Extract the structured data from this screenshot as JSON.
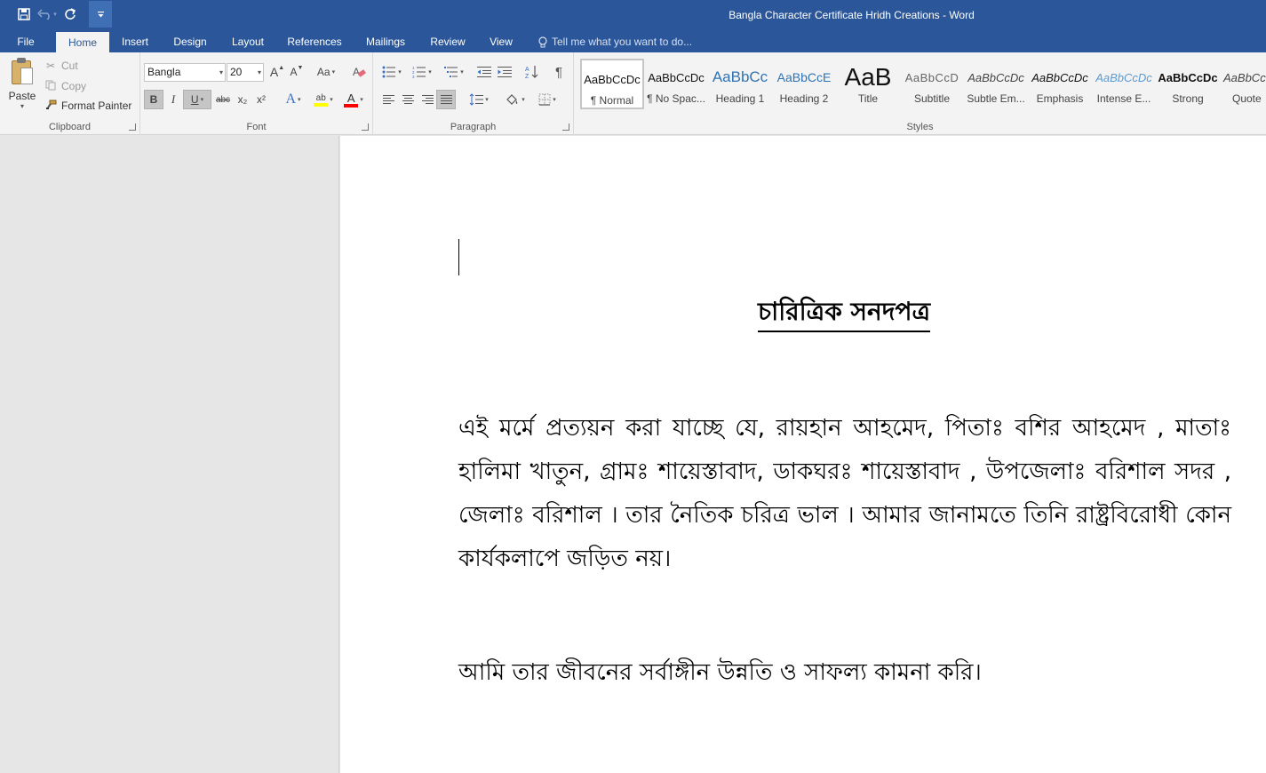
{
  "window": {
    "title": "Bangla Character Certificate Hridh Creations - Word"
  },
  "quick_access": {
    "save_icon": "save-icon",
    "undo_icon": "undo-icon",
    "redo_icon": "redo-icon",
    "customize_icon": "customize-qat-icon"
  },
  "tabs": [
    {
      "label": "File"
    },
    {
      "label": "Home",
      "active": true
    },
    {
      "label": "Insert"
    },
    {
      "label": "Design"
    },
    {
      "label": "Layout"
    },
    {
      "label": "References"
    },
    {
      "label": "Mailings"
    },
    {
      "label": "Review"
    },
    {
      "label": "View"
    }
  ],
  "tell_me": {
    "placeholder": "Tell me what you want to do..."
  },
  "clipboard": {
    "paste_label": "Paste",
    "cut_label": "Cut",
    "copy_label": "Copy",
    "format_painter_label": "Format Painter",
    "group_label": "Clipboard"
  },
  "font": {
    "font_name": "Bangla",
    "font_size": "20",
    "group_label": "Font",
    "bold": "B",
    "italic": "I",
    "underline": "U",
    "strike": "abc",
    "subscript": "x₂",
    "superscript": "x²",
    "grow": "A",
    "shrink": "A",
    "change_case": "Aa",
    "highlight_color": "#ffff00",
    "font_color": "#ff0000"
  },
  "paragraph": {
    "group_label": "Paragraph",
    "pilcrow": "¶"
  },
  "styles": {
    "group_label": "Styles",
    "items": [
      {
        "sample": "AaBbCcDc",
        "name": "¶ Normal",
        "selected": true
      },
      {
        "sample": "AaBbCcDc",
        "name": "¶ No Spac..."
      },
      {
        "sample": "AaBbCc",
        "name": "Heading 1"
      },
      {
        "sample": "AaBbCcE",
        "name": "Heading 2"
      },
      {
        "sample": "AaB",
        "name": "Title"
      },
      {
        "sample": "AaBbCcD",
        "name": "Subtitle"
      },
      {
        "sample": "AaBbCcDc",
        "name": "Subtle Em..."
      },
      {
        "sample": "AaBbCcDc",
        "name": "Emphasis"
      },
      {
        "sample": "AaBbCcDc",
        "name": "Intense E..."
      },
      {
        "sample": "AaBbCcDc",
        "name": "Strong"
      },
      {
        "sample": "AaBbCcDc",
        "name": "Quote"
      }
    ]
  },
  "document": {
    "heading": "চারিত্রিক সনদপত্র",
    "paragraph1": "এই মর্মে প্রত্যয়ন করা যাচ্ছে যে, রায়হান আহমেদ, পিতাঃ বশির আহমেদ , মাতাঃ হালিমা খাতুন,  গ্রামঃ শায়েস্তাবাদ, ডাকঘরঃ শায়েস্তাবাদ , উপজেলাঃ বরিশাল সদর , জেলাঃ বরিশাল । তার নৈতিক চরিত্র ভাল । আমার জানামতে তিনি রাষ্ট্রবিরোধী কোন কার্যকলাপে জড়িত নয়।",
    "paragraph2": "আমি তার জীবনের সর্বাঙ্গীন উন্নতি ও সাফল্য কামনা করি।"
  },
  "colors": {
    "accent": "#2b579a",
    "ribbon_bg": "#f3f3f3",
    "workspace_bg": "#e6e6e6"
  }
}
